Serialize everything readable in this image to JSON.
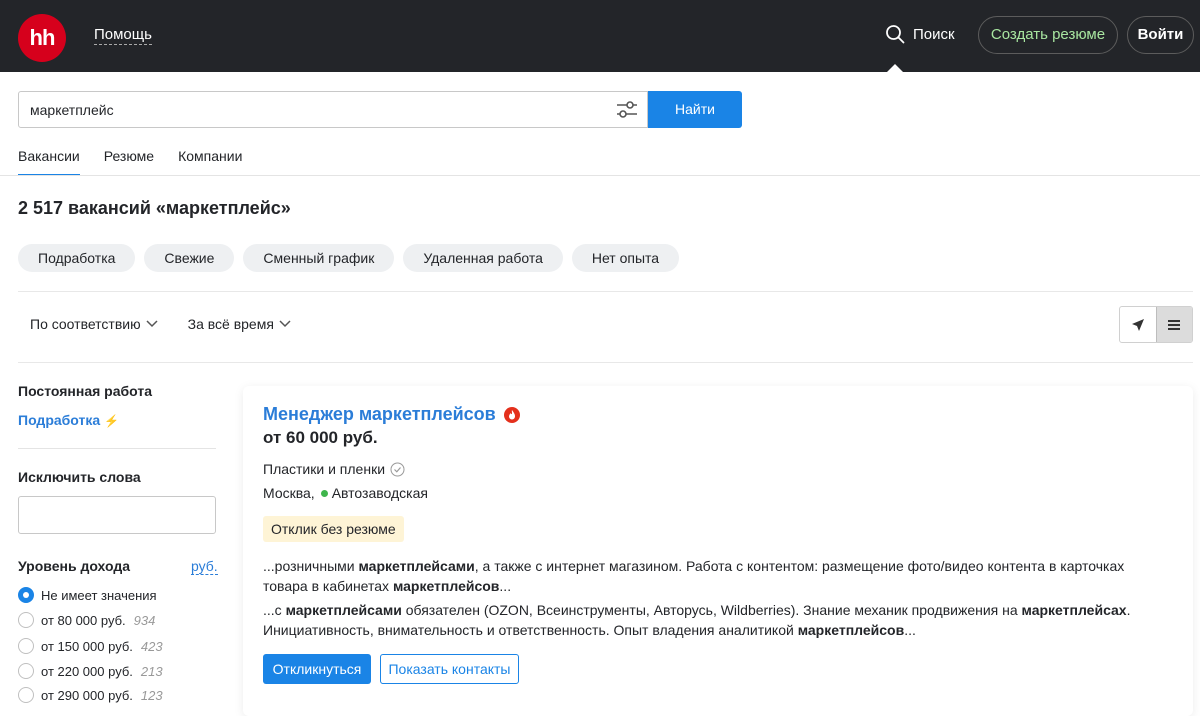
{
  "header": {
    "logo": "hh",
    "help": "Помощь",
    "search": "Поиск",
    "create_resume": "Создать резюме",
    "login": "Войти"
  },
  "search": {
    "query": "маркетплейс",
    "button": "Найти"
  },
  "tabs": [
    "Вакансии",
    "Резюме",
    "Компании"
  ],
  "results_title": "2 517 вакансий «маркетплейс»",
  "chips": [
    "Подработка",
    "Свежие",
    "Сменный график",
    "Удаленная работа",
    "Нет опыта"
  ],
  "sort": {
    "relevance": "По соответствию",
    "period": "За всё время"
  },
  "sidebar": {
    "employment_heading": "Постоянная работа",
    "parttime_link": "Подработка",
    "exclude_heading": "Исключить слова",
    "income_heading": "Уровень дохода",
    "currency_link": "руб.",
    "income_options": [
      {
        "label": "Не имеет значения",
        "count": ""
      },
      {
        "label": "от 80 000 руб.",
        "count": "934"
      },
      {
        "label": "от 150 000 руб.",
        "count": "423"
      },
      {
        "label": "от 220 000 руб.",
        "count": "213"
      },
      {
        "label": "от 290 000 руб.",
        "count": "123"
      }
    ]
  },
  "vacancy": {
    "title": "Менеджер маркетплейсов",
    "salary": "от 60 000 руб.",
    "company": "Пластики и пленки",
    "city": "Москва,",
    "metro": "Автозаводская",
    "badge": "Отклик без резюме",
    "apply": "Откликнуться",
    "contacts": "Показать контакты"
  },
  "colors": {
    "header_bg": "#232529",
    "brand_red": "#d6001c",
    "accent_blue": "#1a84e6",
    "link_blue": "#2b7dd8",
    "resume_green": "#a8e6a0"
  }
}
